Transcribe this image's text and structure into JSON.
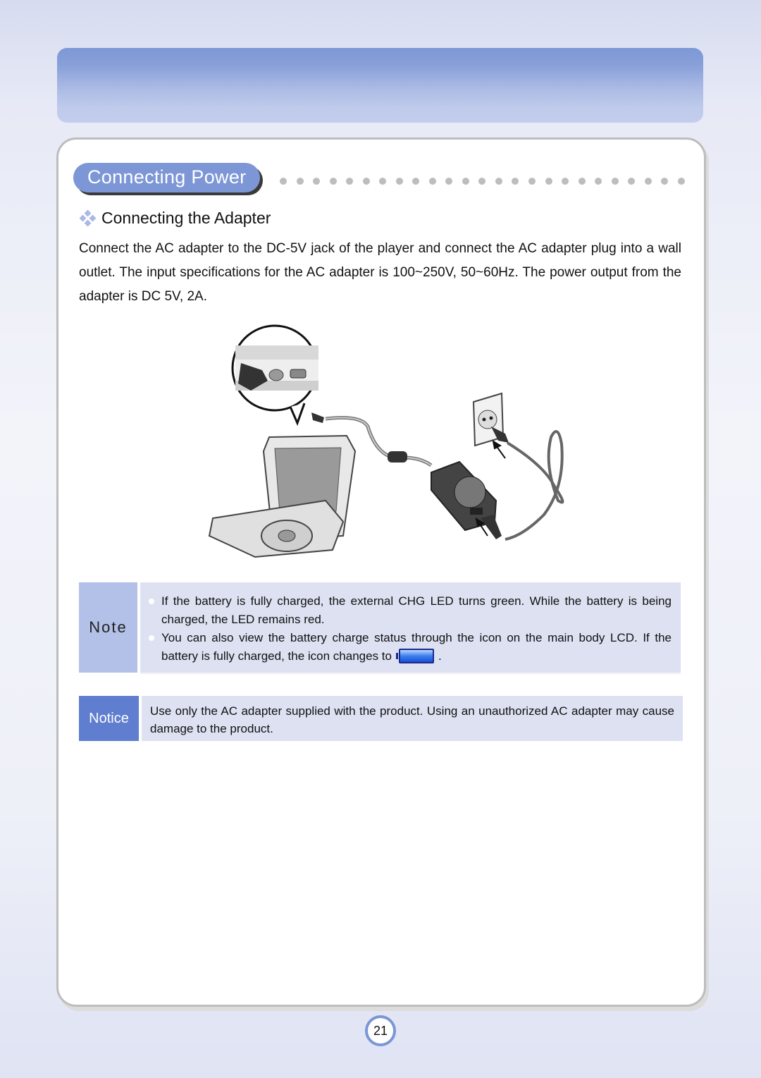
{
  "section": {
    "title": "Connecting Power",
    "subheading": "Connecting the Adapter",
    "body": "Connect the AC adapter to the DC-5V jack of the player and connect the AC adapter plug into a wall outlet. The input specifications for the AC adapter is 100~250V, 50~60Hz. The power output from the adapter is DC 5V, 2A."
  },
  "illustration": {
    "description": "Portable DVD player connected via DC cable to AC adapter, plugged into wall outlet",
    "icons": [
      "portable-player",
      "dc-jack-zoom",
      "ac-adapter",
      "wall-outlet",
      "power-cord"
    ]
  },
  "note": {
    "label": "Note",
    "items": [
      "If the battery is fully charged, the external CHG LED turns green. While the battery is being charged, the LED remains red.",
      "You can also view the battery charge status through the icon on the main body LCD. If the battery is fully charged, the icon changes to"
    ],
    "item_suffix": ".",
    "icon": "battery-full-icon"
  },
  "notice": {
    "label": "Notice",
    "text": "Use only the AC adapter supplied with the product. Using an unauthorized AC adapter may cause damage to the product."
  },
  "footer": {
    "page_number": "21"
  },
  "colors": {
    "accent": "#7d96d6",
    "notice_label": "#5f7ed0",
    "note_label": "#b3c0e7",
    "box_background": "#dde1f2"
  }
}
